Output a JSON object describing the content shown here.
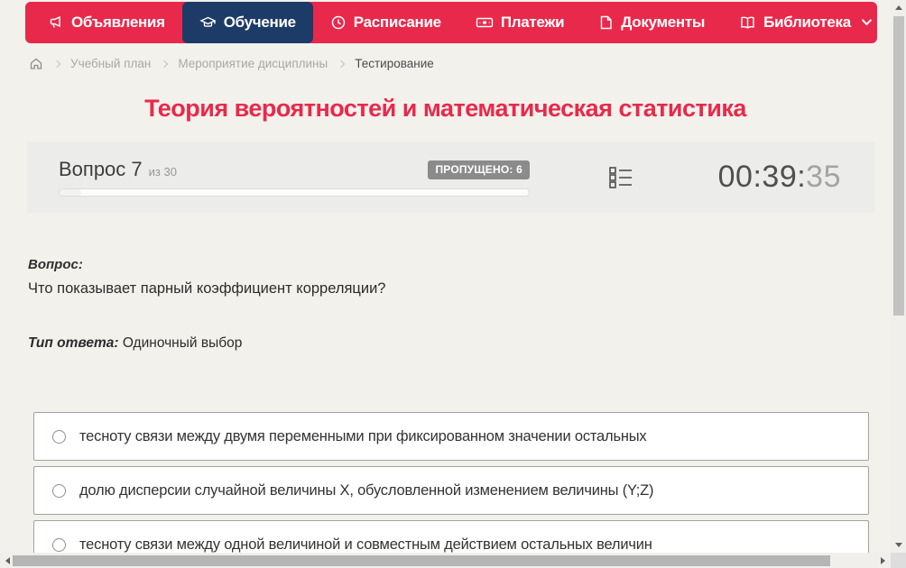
{
  "nav": {
    "items": [
      {
        "label": "Объявления",
        "icon": "megaphone-icon",
        "active": false
      },
      {
        "label": "Обучение",
        "icon": "graduation-cap-icon",
        "active": true
      },
      {
        "label": "Расписание",
        "icon": "clock-icon",
        "active": false
      },
      {
        "label": "Платежи",
        "icon": "banknote-icon",
        "active": false
      },
      {
        "label": "Документы",
        "icon": "document-icon",
        "active": false
      },
      {
        "label": "Библиотека",
        "icon": "book-icon",
        "active": false,
        "has_dropdown": true
      }
    ]
  },
  "breadcrumb": {
    "items": [
      "Учебный план",
      "Мероприятие дисциплины",
      "Тестирование"
    ]
  },
  "page": {
    "title": "Теория вероятностей и математическая статистика"
  },
  "quiz": {
    "question_label": "Вопрос 7",
    "question_total": "из 30",
    "skipped_badge": "ПРОПУЩЕНО: 6",
    "timer": {
      "main": "00:39:",
      "seconds": "35"
    },
    "question_heading": "Вопрос:",
    "question_text": "Что показывает парный коэффициент корреляции?",
    "answer_type_label": "Тип ответа:",
    "answer_type_value": "Одиночный выбор",
    "options": [
      "тесноту связи между двумя переменными при фиксированном значении остальных",
      "долю дисперсии случайной величины X, обусловленной изменением величины (Y;Z)",
      "тесноту связи между одной величиной и совместным действием остальных величин"
    ]
  },
  "colors": {
    "accent_red": "#e8294b",
    "active_navy": "#1d3b67",
    "badge_gray": "#8b8b8b",
    "page_background": "#f3f1ec"
  }
}
